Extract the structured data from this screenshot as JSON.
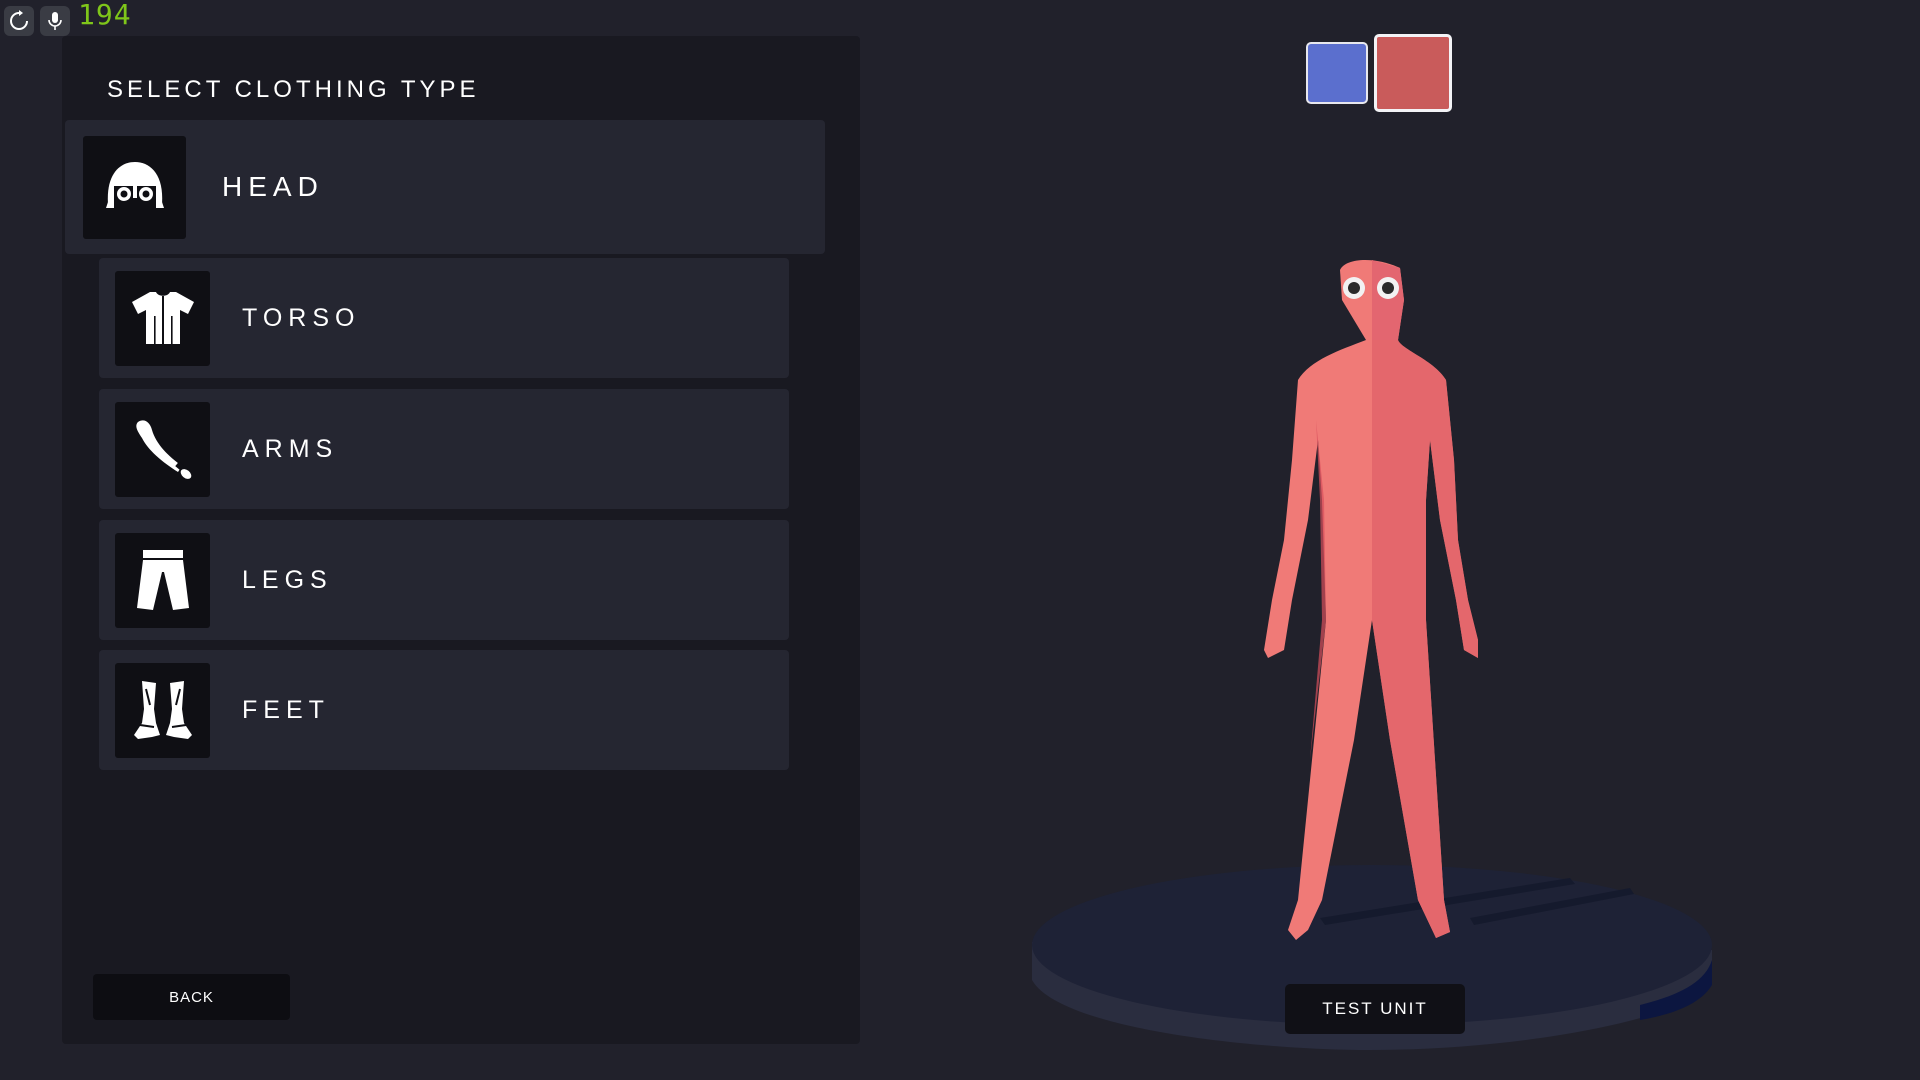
{
  "hud": {
    "fps": "194",
    "icons": [
      "refresh-icon",
      "microphone-icon"
    ]
  },
  "panel": {
    "title": "SELECT CLOTHING TYPE",
    "items": [
      {
        "label": "HEAD",
        "icon": "helmet-icon",
        "selected": true
      },
      {
        "label": "TORSO",
        "icon": "shirt-icon",
        "selected": false
      },
      {
        "label": "ARMS",
        "icon": "arm-icon",
        "selected": false
      },
      {
        "label": "LEGS",
        "icon": "pants-icon",
        "selected": false
      },
      {
        "label": "FEET",
        "icon": "boots-icon",
        "selected": false
      }
    ],
    "back_label": "BACK"
  },
  "team_colors": {
    "swatches": [
      {
        "name": "blue",
        "color": "#5b6fce",
        "selected": false
      },
      {
        "name": "red",
        "color": "#c95b5b",
        "selected": true
      }
    ]
  },
  "preview": {
    "unit_color": "#f07a77",
    "test_label": "TEST UNIT"
  }
}
